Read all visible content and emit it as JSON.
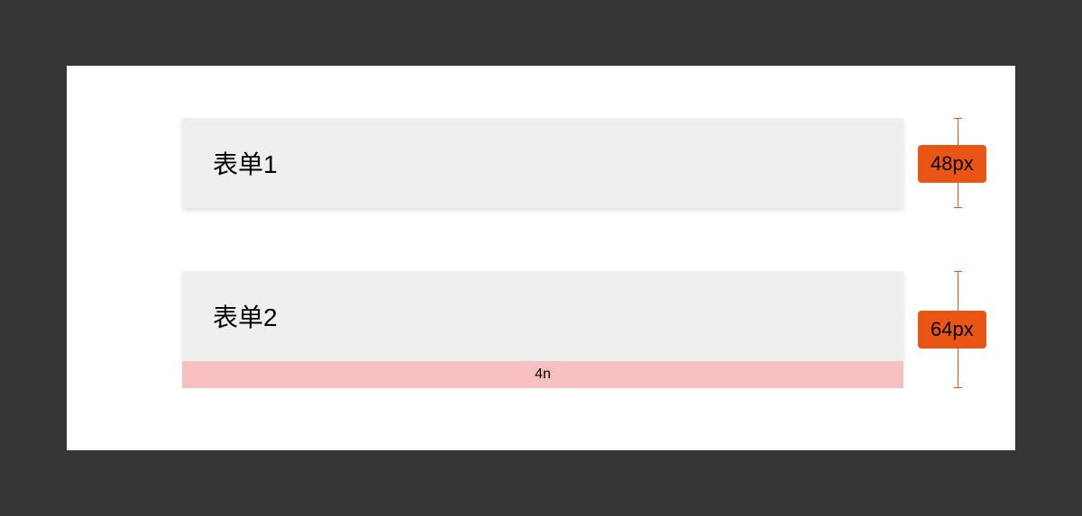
{
  "forms": {
    "row1": {
      "label": "表单1",
      "dimension": "48px"
    },
    "row2": {
      "label": "表单2",
      "dimension": "64px",
      "extra_label": "4n"
    }
  }
}
